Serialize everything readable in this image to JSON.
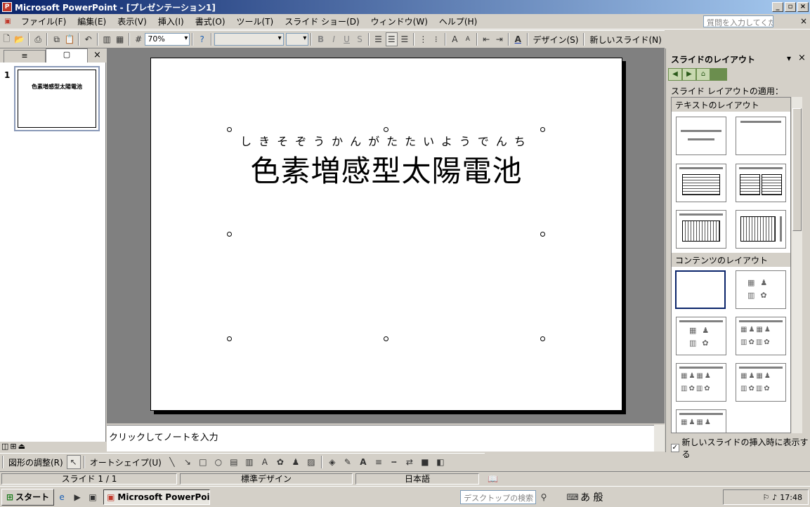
{
  "window": {
    "title": "Microsoft PowerPoint - [プレゼンテーション1]"
  },
  "menu": [
    "ファイル(F)",
    "編集(E)",
    "表示(V)",
    "挿入(I)",
    "書式(O)",
    "ツール(T)",
    "スライド ショー(D)",
    "ウィンドウ(W)",
    "ヘルプ(H)"
  ],
  "help_placeholder": "質問を入力してください",
  "toolbar": {
    "zoom": "70%",
    "design_label": "デザイン(S)",
    "new_slide_label": "新しいスライド(N)",
    "bold": "B",
    "italic": "I",
    "underline": "U",
    "shadow": "S"
  },
  "left_pane": {
    "slide_number": "1",
    "thumb_text": "色素増感型太陽電池"
  },
  "slide": {
    "ruby": "しきそぞうかんがたたいようでんち",
    "title": "色素増感型太陽電池"
  },
  "notes": {
    "placeholder": "クリックしてノートを入力"
  },
  "task_pane": {
    "title": "スライドのレイアウト",
    "apply_label": "スライド レイアウトの適用：",
    "section_text": "テキストのレイアウト",
    "section_content": "コンテンツのレイアウト",
    "show_on_insert": "新しいスライドの挿入時に表示する"
  },
  "drawing": {
    "adjust": "図形の調整(R)",
    "autoshape": "オートシェイプ(U)"
  },
  "status": {
    "slide": "スライド 1 / 1",
    "design": "標準デザイン",
    "language": "日本語"
  },
  "taskbar": {
    "start": "スタート",
    "task": "Microsoft PowerPoi...",
    "search": "デスクトップの検索",
    "ime": "あ 般",
    "clock": "17:48"
  }
}
